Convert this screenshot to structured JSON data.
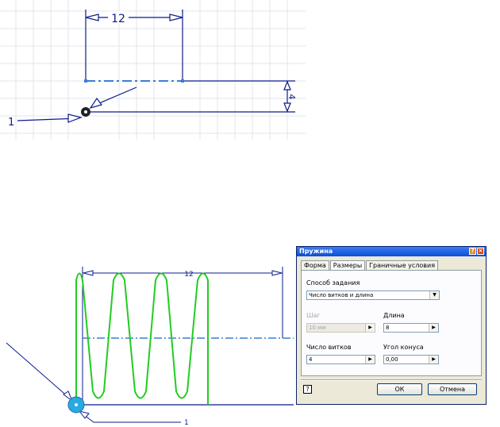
{
  "sketch_top": {
    "width_dim": "12",
    "height_dim": "4",
    "leader_label": "1",
    "colors": {
      "sketch": "#0b1b8c",
      "grid": "#e3e6ee",
      "dash": "#3a7fd4"
    }
  },
  "sketch_bottom": {
    "width_dim": "12",
    "leader_label": "1",
    "colors": {
      "coil": "#22cc22",
      "line": "#0b1b8c",
      "dash": "#3a7fd4",
      "point": "#2aa9e0"
    }
  },
  "dialog": {
    "title": "Пружина",
    "tabs": [
      "Форма",
      "Размеры",
      "Граничные условия"
    ],
    "active_tab": "Размеры",
    "method_label": "Способ задания",
    "method_value": "Число витков и длина",
    "pitch_label": "Шаг",
    "pitch_value": "10 мм",
    "length_label": "Длина",
    "length_value": "8",
    "turns_label": "Число витков",
    "turns_value": "4",
    "taper_label": "Угол конуса",
    "taper_value": "0,00",
    "ok_label": "ОК",
    "cancel_label": "Отмена",
    "help_glyph": "?"
  }
}
